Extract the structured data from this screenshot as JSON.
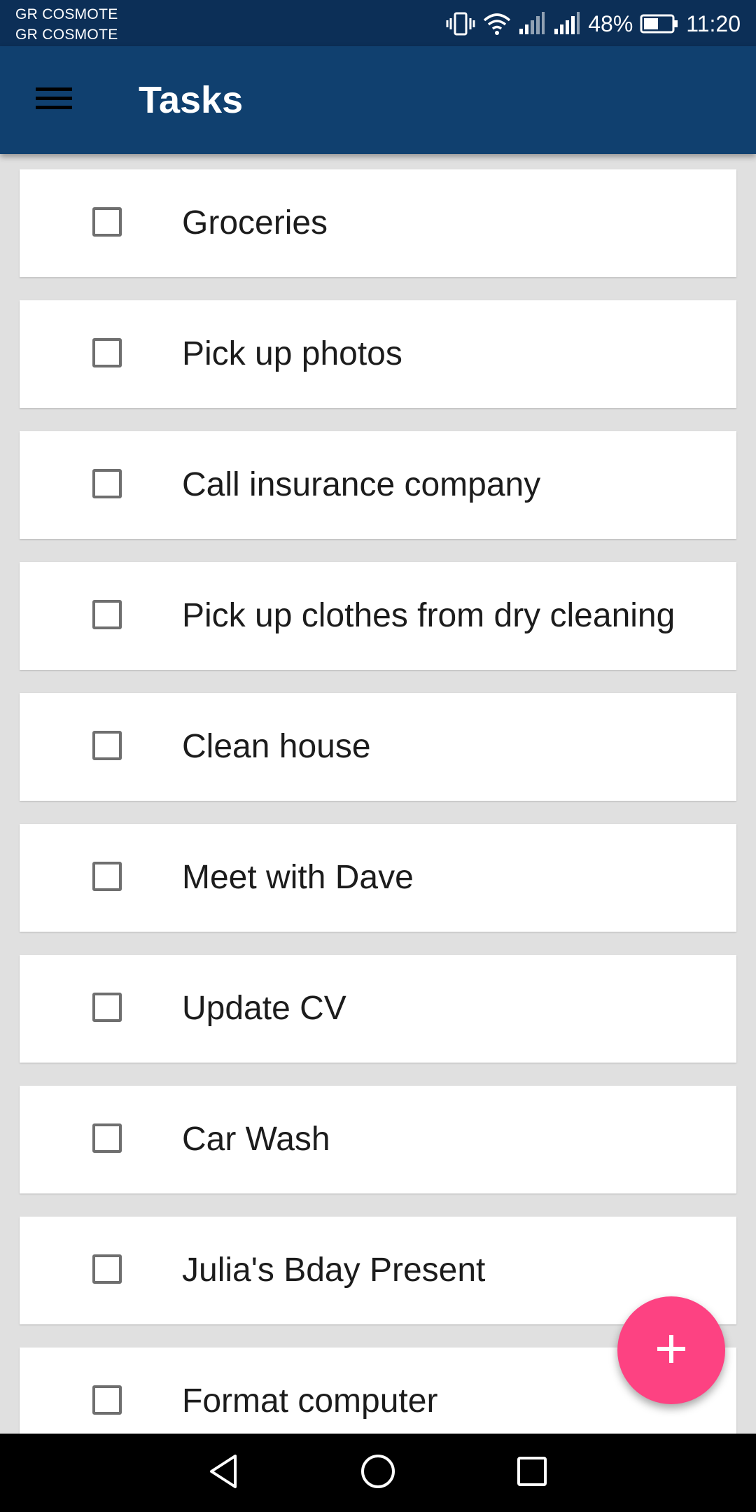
{
  "status_bar": {
    "carrier_1": "GR COSMOTE",
    "carrier_2": "GR COSMOTE",
    "battery": "48%",
    "time": "11:20",
    "icons": [
      "vibrate-icon",
      "wifi-icon",
      "signal-icon",
      "signal-icon",
      "battery-icon"
    ]
  },
  "app_bar": {
    "title": "Tasks",
    "menu_icon": "hamburger-menu-icon",
    "background": "#10406f"
  },
  "tasks": [
    {
      "label": "Groceries",
      "checked": false
    },
    {
      "label": "Pick up photos",
      "checked": false
    },
    {
      "label": "Call insurance company",
      "checked": false
    },
    {
      "label": "Pick up clothes from dry cleaning",
      "checked": false
    },
    {
      "label": "Clean house",
      "checked": false
    },
    {
      "label": "Meet with Dave",
      "checked": false
    },
    {
      "label": "Update CV",
      "checked": false
    },
    {
      "label": "Car Wash",
      "checked": false
    },
    {
      "label": "Julia's Bday Present",
      "checked": false
    },
    {
      "label": "Format computer",
      "checked": false
    }
  ],
  "fab": {
    "icon": "plus-icon",
    "color": "#fd4282"
  },
  "nav_bar": {
    "icons": [
      "back-icon",
      "home-icon",
      "recents-icon"
    ]
  }
}
